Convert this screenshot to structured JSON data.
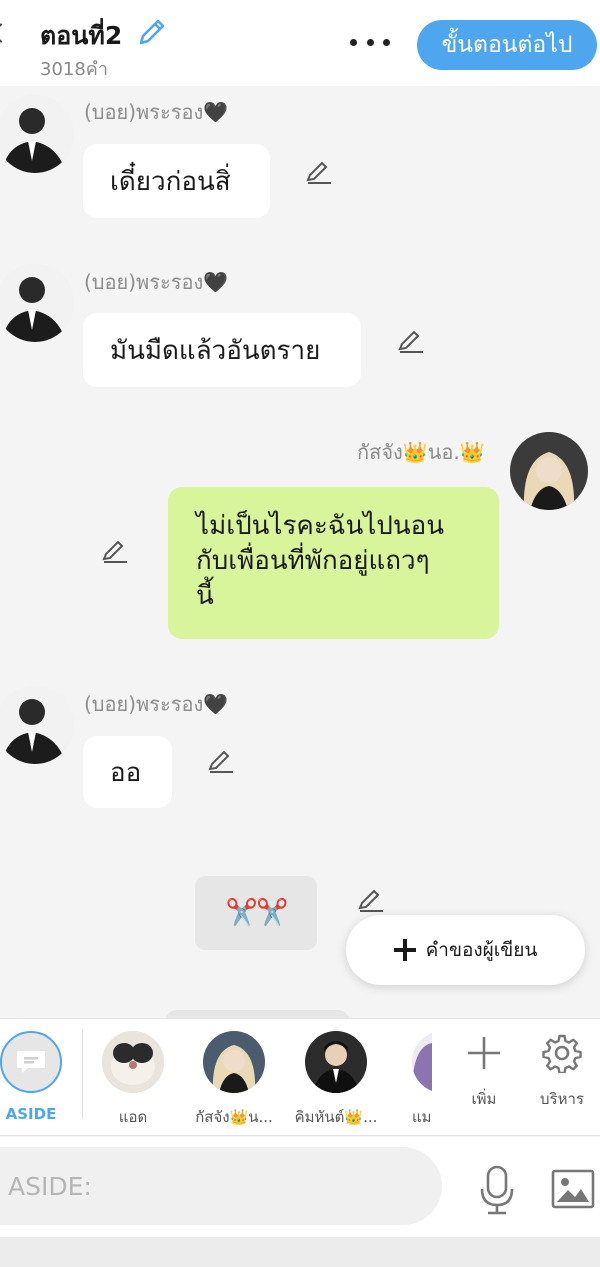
{
  "header": {
    "episode_title": "ตอนที่2",
    "word_count": "3018คำ",
    "next_button": "ขั้นตอนต่อไป"
  },
  "messages": [
    {
      "sender": "(บอย)พระรอง🖤",
      "text": "เดี๋ยวก่อนสิ่",
      "side": "left"
    },
    {
      "sender": "(บอย)พระรอง🖤",
      "text": "มันมืดแล้วอันตราย",
      "side": "left"
    },
    {
      "sender": "กัสจัง👑นอ.👑",
      "lines": [
        "ไม่เป็นไรคะฉันไปนอน",
        "กับเพื่อนที่พักอยู่แถวๆ",
        "นี้"
      ],
      "side": "right"
    },
    {
      "sender": "(บอย)พระรอง🖤",
      "text": "ออ",
      "side": "left"
    }
  ],
  "scene_break": "✂️✂️",
  "author_note_button": "คำของผู้เขียน",
  "character_bar": {
    "aside_label": "ASIDE",
    "characters": [
      {
        "label": "แอด"
      },
      {
        "label": "กัสจัง👑น..."
      },
      {
        "label": "คิมหันต์👑..."
      },
      {
        "label": "แม"
      }
    ],
    "add_label": "เพิ่ม",
    "manage_label": "บริหาร"
  },
  "input": {
    "placeholder": "ASIDE:"
  },
  "colors": {
    "accent": "#4da6ee",
    "my_bubble": "#d8f59b",
    "other_bubble": "#ffffff",
    "background": "#f4f4f4"
  }
}
